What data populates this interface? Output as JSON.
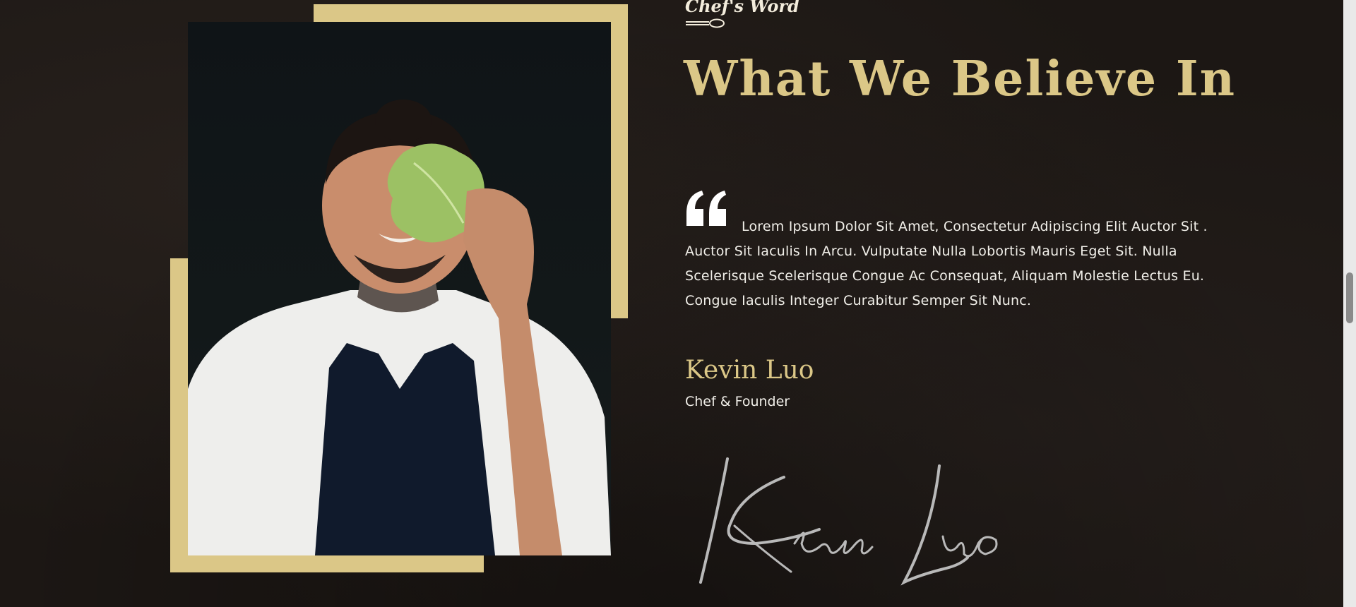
{
  "section": {
    "subtitle": "Chef's Word",
    "heading": "What We Believe In"
  },
  "quote": {
    "text": "Lorem Ipsum Dolor Sit Amet, Consectetur Adipiscing Elit Auctor Sit . Auctor Sit Iaculis In Arcu. Vulputate Nulla Lobortis Mauris Eget Sit. Nulla Scelerisque Scelerisque Congue Ac Consequat, Aliquam Molestie Lectus Eu. Congue Iaculis Integer Curabitur Semper Sit Nunc."
  },
  "author": {
    "name": "Kevin Luo",
    "role": "Chef & Founder",
    "signature": "Kevin Luo"
  },
  "image": {
    "description_icon": "chef-photo"
  },
  "icons": {
    "divider": "spoon-icon",
    "quote": "quote-icon"
  },
  "colors": {
    "accent": "#dbc787",
    "background": "#1c1714",
    "text": "#f1efe9"
  }
}
